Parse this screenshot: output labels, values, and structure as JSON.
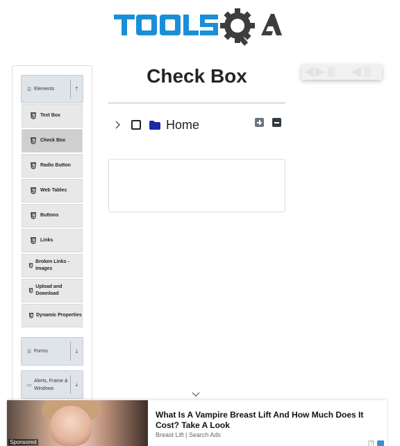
{
  "header": {
    "logo_text": "TOOLSQA",
    "logo_icon": "gear-icon"
  },
  "sidebar": {
    "groups": [
      {
        "label": "Elements",
        "icon": "list-icon",
        "toggle_icon": "chevron-up-icon"
      },
      {
        "label": "Forms",
        "icon": "list-icon",
        "toggle_icon": "chevron-down-icon"
      },
      {
        "label": "Alerts, Frame & Windows",
        "icon": "window-icon",
        "toggle_icon": "chevron-down-icon"
      }
    ],
    "items": [
      {
        "label": "Text Box",
        "icon": "html5-icon",
        "active": false
      },
      {
        "label": "Check Box",
        "icon": "html5-icon",
        "active": true
      },
      {
        "label": "Radio Button",
        "icon": "html5-icon",
        "active": false
      },
      {
        "label": "Web Tables",
        "icon": "html5-icon",
        "active": false
      },
      {
        "label": "Buttons",
        "icon": "html5-icon",
        "active": false
      },
      {
        "label": "Links",
        "icon": "html5-icon",
        "active": false
      },
      {
        "label": "Broken Links - Images",
        "icon": "html5-icon",
        "active": false
      },
      {
        "label": "Upload and Download",
        "icon": "html5-icon",
        "active": false
      },
      {
        "label": "Dynamic Properties",
        "icon": "html5-icon",
        "active": false
      }
    ]
  },
  "main": {
    "title": "Check Box",
    "tree": {
      "root_label": "Home",
      "expand_all_icon": "plus-square-icon",
      "collapse_all_icon": "minus-square-icon"
    }
  },
  "ad": {
    "headline": "What Is A Vampire Breast Lift And How Much Does It Cost? Take A Look",
    "source": "Breast Lift | Search Ads",
    "sponsored_label": "Sponsored",
    "adchoices_label": "[?]"
  },
  "colors": {
    "logo_blue": "#1a8fd8",
    "logo_dark": "#3d3d3d",
    "folder_blue": "#1b2aa6",
    "menu_group_bg": "#dfe3ea"
  }
}
